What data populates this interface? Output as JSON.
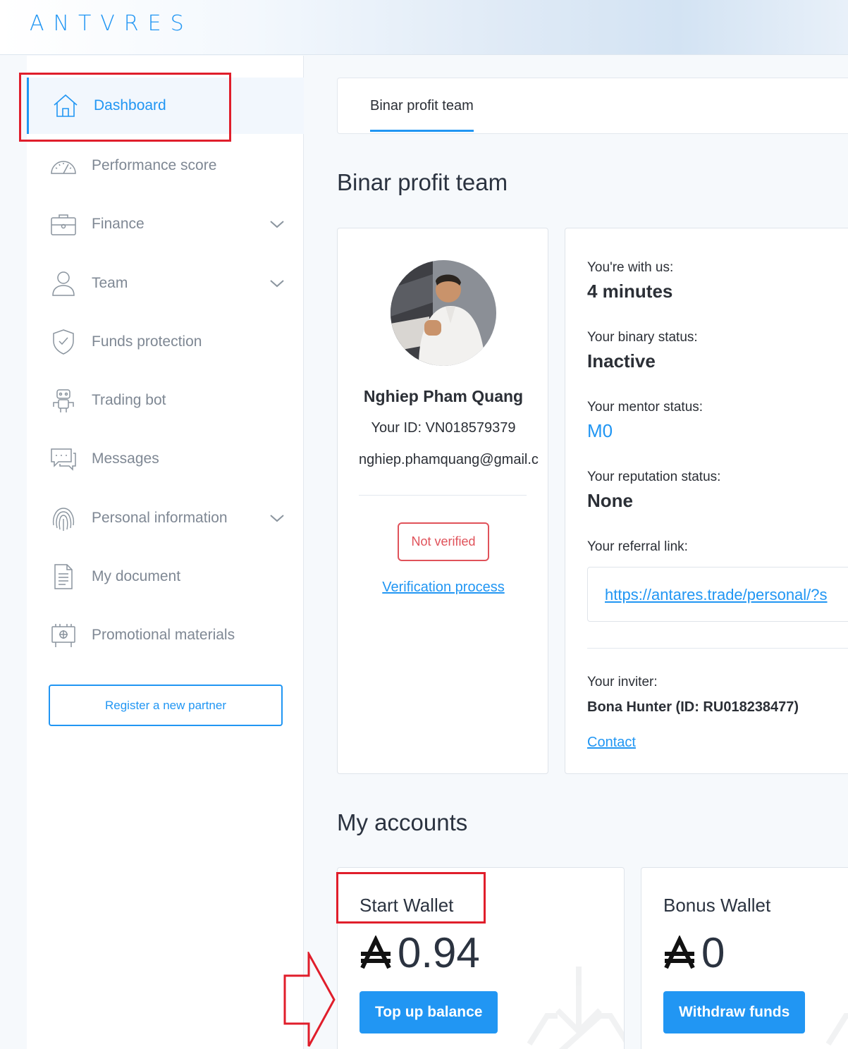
{
  "header": {
    "logo_text": "ANTVRES"
  },
  "sidebar": {
    "items": [
      {
        "label": "Dashboard",
        "icon": "home-icon",
        "active": true
      },
      {
        "label": "Performance score",
        "icon": "speedometer-icon"
      },
      {
        "label": "Finance",
        "icon": "briefcase-icon",
        "expandable": true
      },
      {
        "label": "Team",
        "icon": "user-icon",
        "expandable": true
      },
      {
        "label": "Funds protection",
        "icon": "shield-check-icon"
      },
      {
        "label": "Trading bot",
        "icon": "robot-icon"
      },
      {
        "label": "Messages",
        "icon": "chat-icon"
      },
      {
        "label": "Personal information",
        "icon": "fingerprint-icon",
        "expandable": true
      },
      {
        "label": "My document",
        "icon": "document-icon"
      },
      {
        "label": "Promotional materials",
        "icon": "easel-icon"
      }
    ],
    "register_button": "Register a new partner"
  },
  "main": {
    "tab_label": "Binar profit team",
    "page_title": "Binar profit team",
    "profile": {
      "name": "Nghiep Pham Quang",
      "id_text": "Your ID: VN018579379",
      "email": "nghiep.phamquang@gmail.c",
      "verification_badge": "Not verified",
      "verification_link": "Verification process"
    },
    "info": {
      "with_us_label": "You're with us:",
      "with_us_value": "4 minutes",
      "binary_label": "Your binary status:",
      "binary_value": "Inactive",
      "mentor_label": "Your mentor status:",
      "mentor_value": "M0",
      "reputation_label": "Your reputation status:",
      "reputation_value": "None",
      "referral_label": "Your referral link:",
      "referral_link": "https://antares.trade/personal/?s",
      "inviter_label": "Your inviter:",
      "inviter_value": "Bona Hunter (ID: RU018238477)",
      "contact_link": "Contact"
    },
    "accounts_title": "My accounts",
    "wallets": [
      {
        "name": "Start Wallet",
        "amount": "0.94",
        "button": "Top up balance"
      },
      {
        "name": "Bonus Wallet",
        "amount": "0",
        "button": "Withdraw funds"
      }
    ]
  },
  "colors": {
    "accent": "#2196f3",
    "danger": "#e0525a",
    "annotation": "#e01e2b"
  }
}
